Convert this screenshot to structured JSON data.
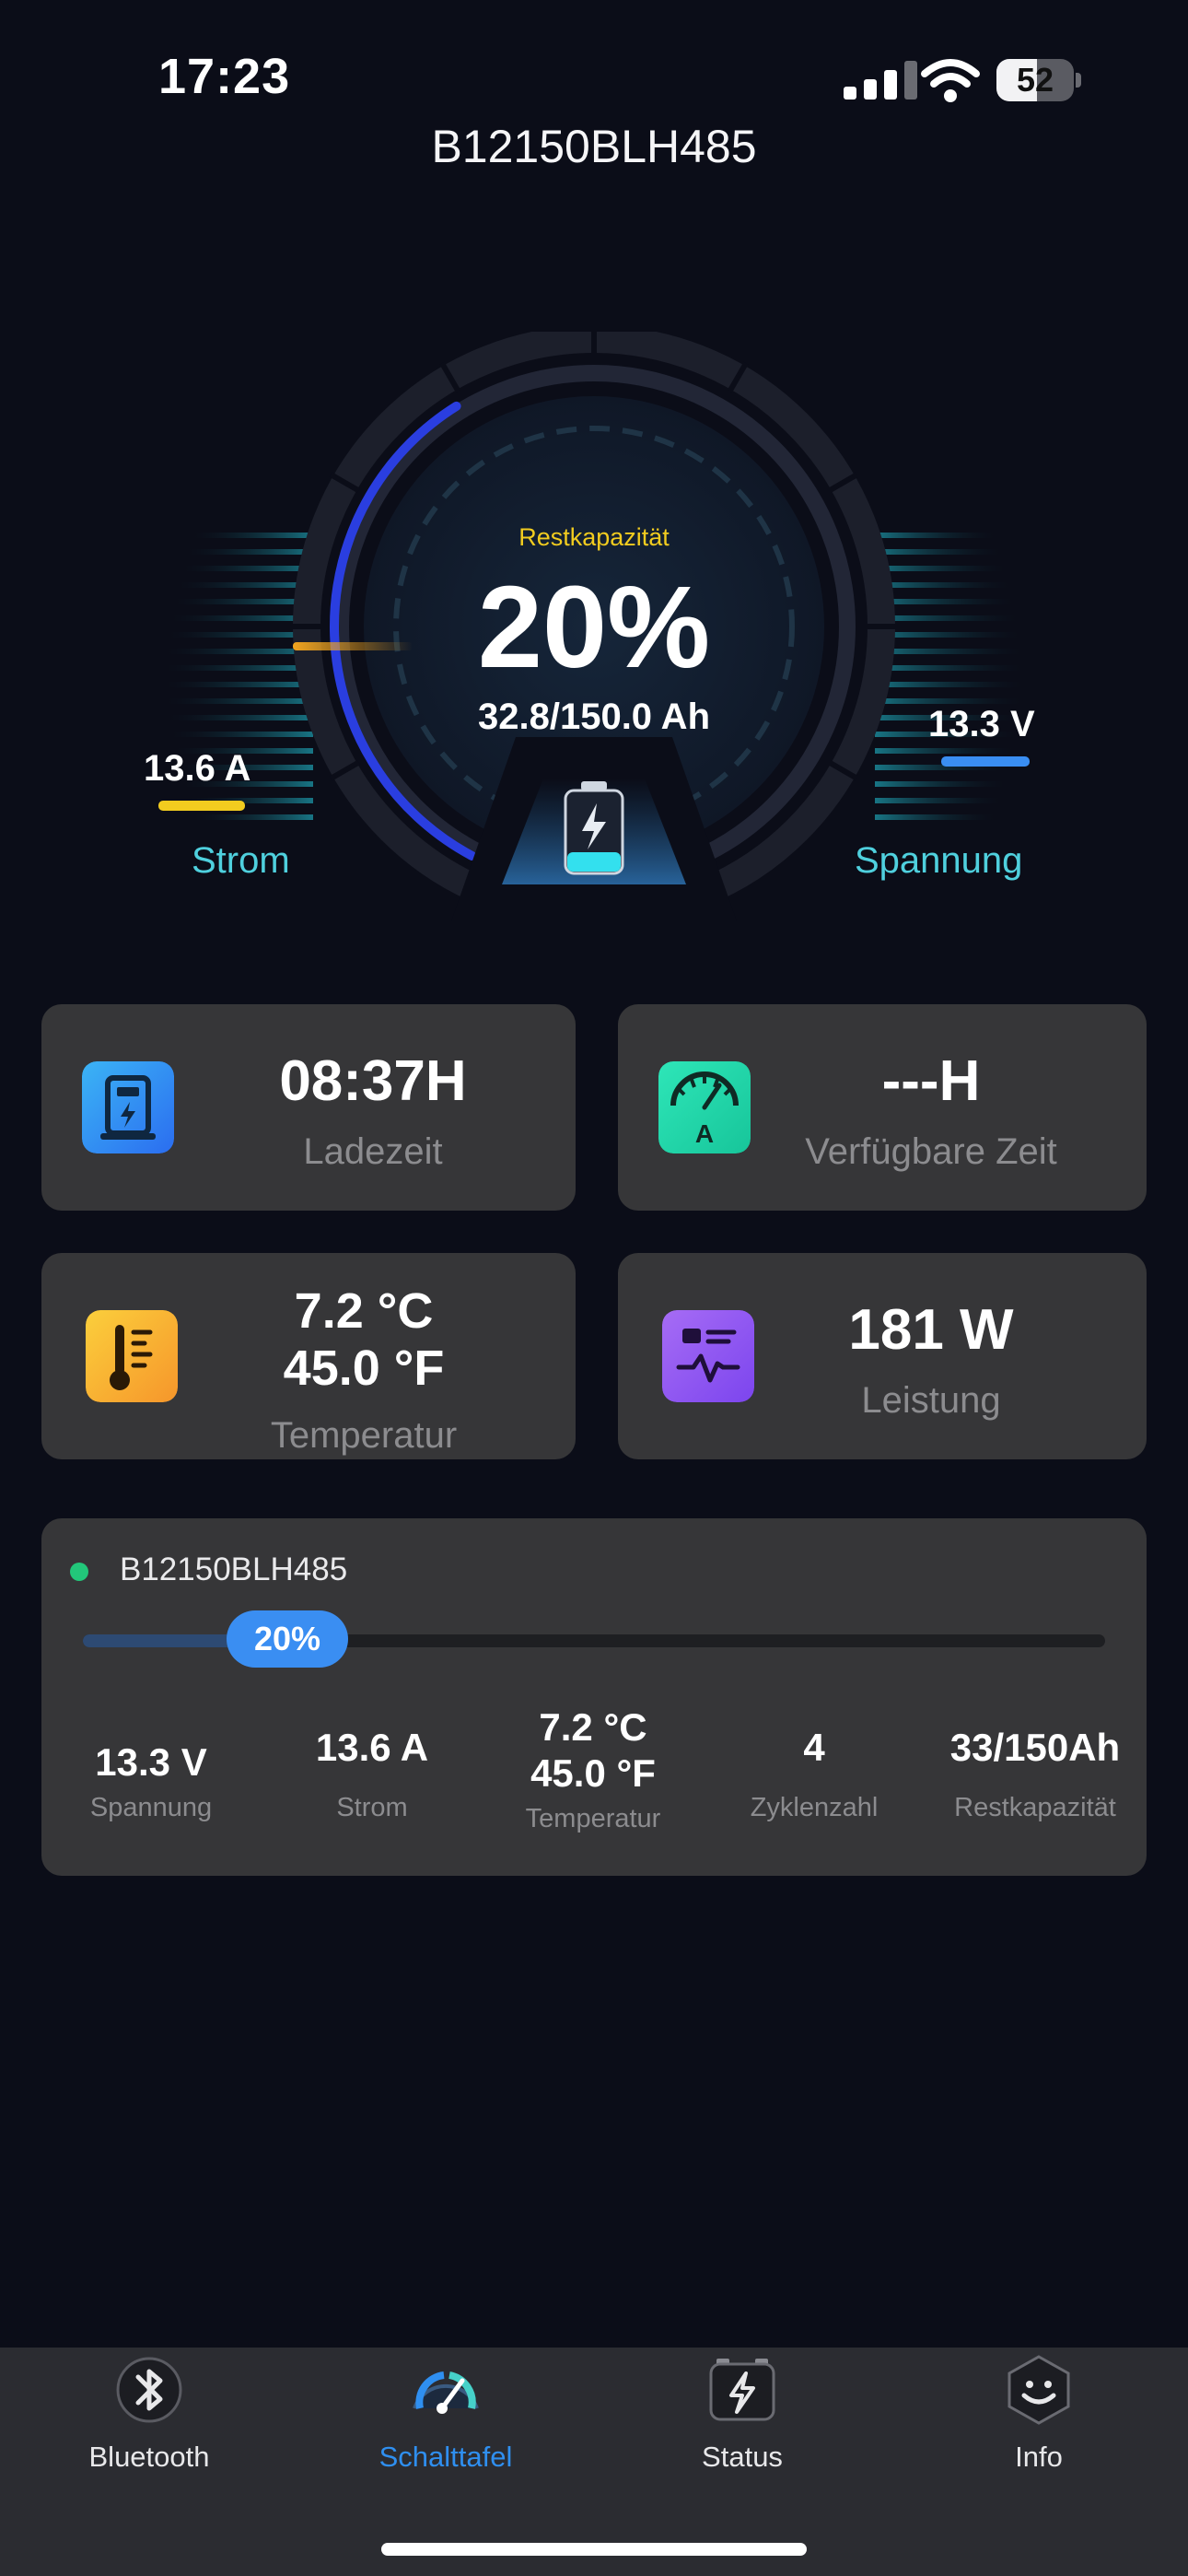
{
  "status_bar": {
    "time": "17:23",
    "battery": "52",
    "battery_level": 0.52
  },
  "header": {
    "title": "B12150BLH485"
  },
  "gauge": {
    "label": "Restkapazität",
    "percent": "20%",
    "percent_value": 0.2,
    "capacity": "32.8/150.0 Ah",
    "current_value": "13.6 A",
    "current_label": "Strom",
    "voltage_value": "13.3 V",
    "voltage_label": "Spannung"
  },
  "cards": {
    "charge_time": {
      "value": "08:37H",
      "label": "Ladezeit"
    },
    "available_time": {
      "value": "---H",
      "label": "Verfügbare Zeit"
    },
    "temperature": {
      "value_c": "7.2 °C",
      "value_f": "45.0 °F",
      "label": "Temperatur"
    },
    "power": {
      "value": "181 W",
      "label": "Leistung"
    }
  },
  "battery_panel": {
    "name": "B12150BLH485",
    "percent": "20%",
    "percent_value": 0.2,
    "stats": [
      {
        "value": "13.3 V",
        "label": "Spannung"
      },
      {
        "value": "13.6 A",
        "label": "Strom"
      },
      {
        "value": "7.2 °C\n45.0 °F",
        "label": "Temperatur"
      },
      {
        "value": "4",
        "label": "Zyklenzahl"
      },
      {
        "value": "33/150Ah",
        "label": "Restkapazität"
      }
    ]
  },
  "tabs": [
    {
      "label": "Bluetooth",
      "icon": "bluetooth-icon"
    },
    {
      "label": "Schalttafel",
      "icon": "speedometer-icon",
      "active": true
    },
    {
      "label": "Status",
      "icon": "battery-bolt-icon"
    },
    {
      "label": "Info",
      "icon": "smiley-hexagon-icon"
    }
  ],
  "colors": {
    "background": "#0b0d18",
    "card": "#363638",
    "accent_blue": "#2f8ff0",
    "teal": "#4fd0de",
    "yellow": "#f2cc1f",
    "online_green": "#22c77a"
  }
}
